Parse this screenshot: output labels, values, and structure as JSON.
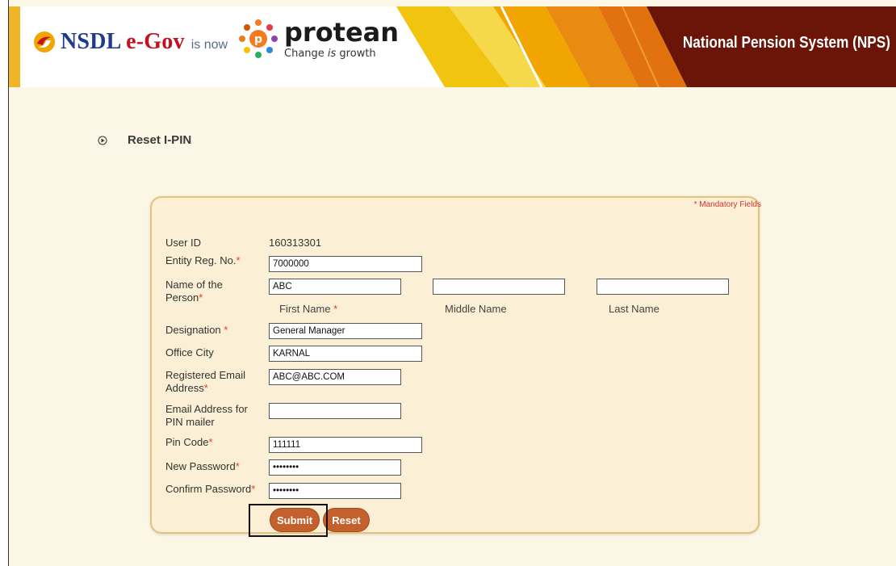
{
  "header": {
    "nsdl_name": "NSDL",
    "nsdl_egov": "e-Gov",
    "is_now": "is now",
    "protean_word": "protean",
    "tagline_pre": "Change ",
    "tagline_is": "is",
    "tagline_post": " growth",
    "system_title": "National Pension System (NPS)"
  },
  "page": {
    "heading": "Reset I-PIN"
  },
  "form": {
    "mandatory_note": "* Mandatory Fields",
    "required_mark": "*",
    "user_id_label": "User ID",
    "user_id_value": "160313301",
    "entity_reg_label": "Entity Reg. No.",
    "entity_reg_value": "7000000",
    "name_label_line1": "Name of the",
    "name_label_line2": "Person",
    "first_name_value": "ABC",
    "middle_name_value": "",
    "last_name_value": "",
    "first_name_caption": "First Name ",
    "middle_name_caption": "Middle Name",
    "last_name_caption": "Last Name",
    "designation_label": "Designation ",
    "designation_value": "General Manager",
    "office_city_label": "Office City",
    "office_city_value": "KARNAL",
    "reg_email_label_line1": "Registered Email",
    "reg_email_label_line2": "Address",
    "reg_email_value": "ABC@ABC.COM",
    "pin_email_label_line1": "Email Address for",
    "pin_email_label_line2": "PIN mailer",
    "pin_email_value": "",
    "pin_code_label": "Pin Code",
    "pin_code_value": "111111",
    "new_password_label": "New Password",
    "new_password_value": "password",
    "confirm_password_label": "Confirm Password",
    "confirm_password_value": "password",
    "submit_label": "Submit",
    "reset_label": "Reset"
  },
  "colors": {
    "header_dark": "#6b1408",
    "accent_orange": "#f0a500",
    "button": "#c3602e",
    "required": "#e23b2e"
  }
}
